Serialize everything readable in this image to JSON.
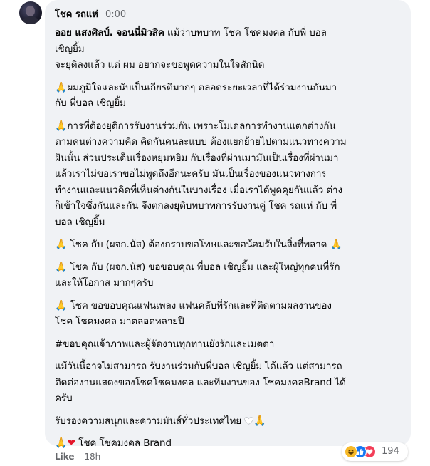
{
  "comment": {
    "author": "โชค รถแห่",
    "time": "0:00",
    "paragraphs": {
      "p1": {
        "mention": "ออย แสงศิลป์. จอนนี่มิวสิค",
        "l1": " แม้ว่าบทบาท โชค โชคมงคล กับพี่ บอล",
        "l2": "เชิญยิ้ม",
        "l3": "จะยุติลงแล้ว แต่ ผม อยากจะขอพูดความในใจสักนิด"
      },
      "p2": {
        "l1": "ผมภูมิใจและนับเป็นเกียรติมากๆ ตลอดระยะเวลาที่ได้ร่วมงานกันมา",
        "l2": "กับ พี่บอล เชิญยิ้ม"
      },
      "p3": {
        "l1": "การที่ต้องยุติการรับงานร่วมกัน เพราะโมเดลการทำงานแตกต่างกัน",
        "l2": "ตามคนต่างความคิด คิดกันคนละแบบ ต้องแยกย้ายไปตามแนวทางความ",
        "l3": "ฝันนั้น ส่วนประเด็นเรื่องหยุมหยิม กับเรื่องที่ผ่านมามันเป็นเรื่องที่ผ่านมา",
        "l4": "แล้วเราไม่ขอเราขอไม่พูดถึงอีกนะครับ มันเป็นเรื่องของแนวทางการ",
        "l5": "ทำงานและแนวคิดที่เห็นต่างกันในบางเรื่อง เมื่อเราได้พูดคุยกันแล้ว ต่าง",
        "l6": "ก็เข้าใจซึ่งกันและกัน จึงตกลงยุติบทบาทการรับงานคู่ โชค รถแห่ กับ พี่",
        "l7": "บอล เชิญยิ้ม"
      },
      "p4": {
        "l1": "โชค กับ (ผจก.นัส) ต้องกราบขอโทษและขอน้อมรับในสิ่งที่พลาด"
      },
      "p5": {
        "l1": "โชค กับ (ผจก.นัส) ขอขอบคุณ พี่บอล เชิญยิ้ม และผู้ใหญ่ทุกคนที่รัก",
        "l2": "และให้โอกาส มากๆครับ"
      },
      "p6": {
        "l1": "โชค ขอขอบคุณแฟนเพลง แฟนคลับที่รักและที่ติดตามผลงานของ",
        "l2": "โชค โชคมงคล มาตลอดหลายปี"
      },
      "p7": {
        "l1": "#ขอบคุณเจ้าภาพและผู้จัดงานทุกท่านยังรักและเมตตา"
      },
      "p8": {
        "l1": "แม้วันนี้อาจไม่สามารถ รับงานร่วมกับพี่บอล เชิญยิ้ม ได้แล้ว แต่สามารถ",
        "l2": "ติดต่องานแสดงของโชคโชคมงคล และทีมงานของ โชคมงคลBrand ได้",
        "l3": "ครับ"
      },
      "p9": {
        "l1": "รับรองความสนุกและความมันส์ทั่วประเทศไทย"
      },
      "p10": {
        "l1": "โชค โชคมงคล Brand"
      }
    },
    "emoji": {
      "pray": "🙏",
      "heart": "❤"
    }
  },
  "footer": {
    "like": "Like",
    "age": "18h"
  },
  "reactions": {
    "count": "194",
    "types": [
      "haha-icon",
      "like-icon",
      "love-icon"
    ]
  },
  "colors": {
    "bubble": "#f0f2f5",
    "meta": "#65676b",
    "like_blue": "#1877f2",
    "love_red": "#f33e58",
    "haha_yellow": "#f7b928"
  }
}
